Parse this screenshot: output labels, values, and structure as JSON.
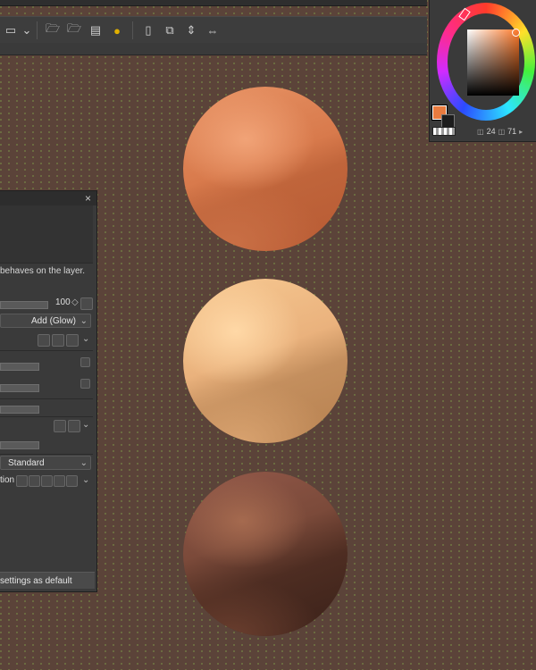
{
  "toolbar": {
    "buttons": [
      "scanner-icon",
      "chevron-down-icon",
      "open-folder-icon",
      "open-folder-alt-icon",
      "export-icon",
      "color-palette-icon",
      "document-icon",
      "duplicate-icon",
      "flip-vertical-icon",
      "flip-horizontal-icon"
    ]
  },
  "color_panel": {
    "main_color": "#e87b3f",
    "sub_color": "#1c1c1c",
    "hsv": {
      "h": "24",
      "s": "71"
    }
  },
  "canvas": {
    "background": "#5b4339"
  },
  "tool_property": {
    "close": "×",
    "description": "behaves on the layer.",
    "opacity_value": "100",
    "blending_mode": "Add (Glow)",
    "standard_dropdown": "Standard",
    "label_option": "tion",
    "footer_button": "settings as default"
  }
}
